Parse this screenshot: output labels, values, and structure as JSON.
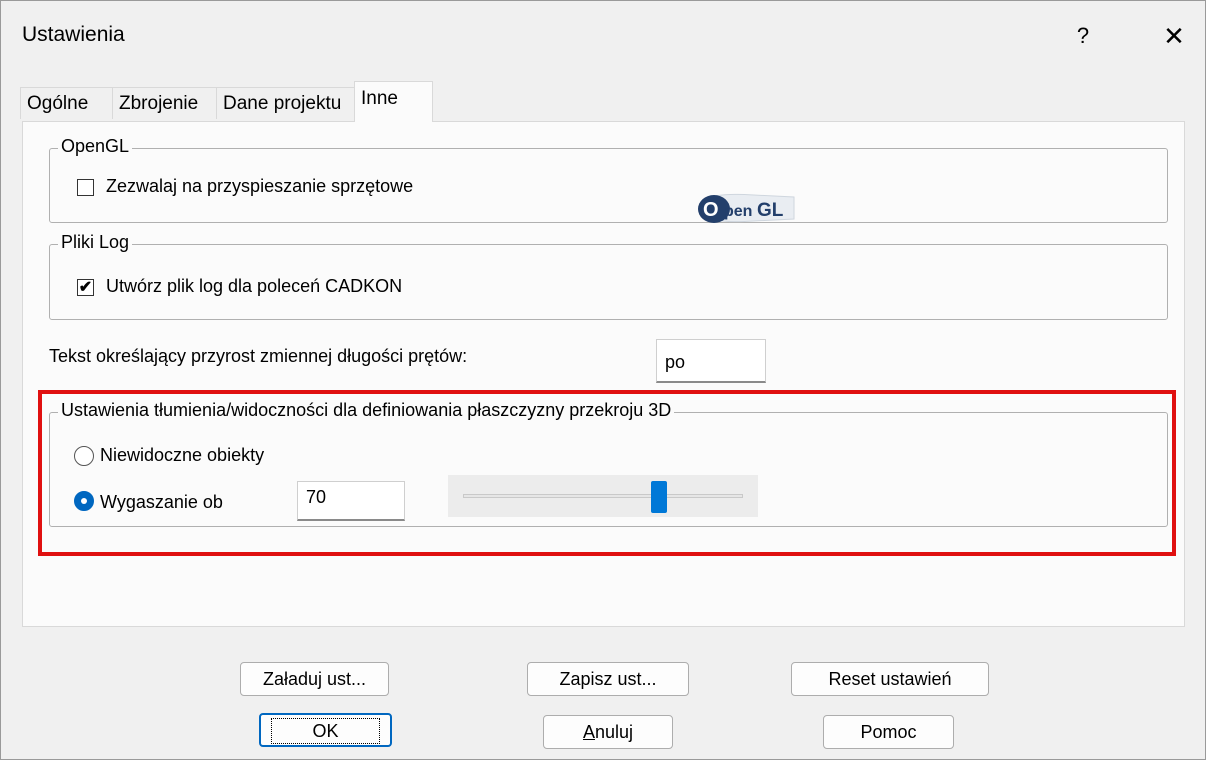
{
  "window": {
    "title": "Ustawienia",
    "help_glyph": "?",
    "close_glyph": "✕"
  },
  "tabs": [
    {
      "label": "Ogólne",
      "active": false
    },
    {
      "label": "Zbrojenie",
      "active": false
    },
    {
      "label": "Dane projektu",
      "active": false
    },
    {
      "label": "Inne",
      "active": true
    }
  ],
  "opengl": {
    "group_label": "OpenGL",
    "hw_accel_label": "Zezwalaj na przyspieszanie sprzętowe",
    "hw_accel_checked": false,
    "logo_text_o": "O",
    "logo_text_pen": "pen",
    "logo_text_gl": "GL"
  },
  "log_files": {
    "group_label": "Pliki Log",
    "create_log_label": "Utwórz plik log dla poleceń CADKON",
    "create_log_checked": true
  },
  "increment_text": {
    "label": "Tekst określający przyrost zmiennej długości prętów:",
    "value": "po"
  },
  "section_plane": {
    "group_label": "Ustawienia tłumienia/widoczności dla definiowania płaszczyzny przekroju 3D",
    "invisible_label": "Niewidoczne obiekty",
    "invisible_selected": false,
    "fade_label": "Wygaszanie ob",
    "fade_selected": true,
    "fade_value": "70",
    "fade_slider_fraction": 0.7
  },
  "buttons": {
    "load": "Załaduj ust...",
    "save": "Zapisz ust...",
    "reset": "Reset ustawień",
    "ok": "OK",
    "cancel_prefix": "A",
    "cancel_rest": "nuluj",
    "help": "Pomoc"
  },
  "colors": {
    "accent": "#0067c0",
    "highlight_frame": "#e01010"
  }
}
